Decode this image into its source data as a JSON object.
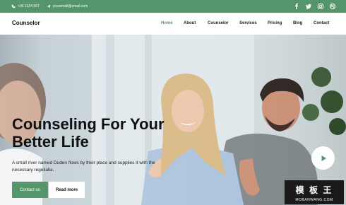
{
  "topbar": {
    "phone": "+00 1234 567",
    "email": "youremail@email.com",
    "social": [
      "facebook-icon",
      "twitter-icon",
      "instagram-icon",
      "dribbble-icon"
    ]
  },
  "navbar": {
    "brand": "Counselor",
    "items": [
      {
        "label": "Home",
        "active": true
      },
      {
        "label": "About",
        "active": false
      },
      {
        "label": "Counselor",
        "active": false
      },
      {
        "label": "Services",
        "active": false
      },
      {
        "label": "Pricing",
        "active": false
      },
      {
        "label": "Blog",
        "active": false
      },
      {
        "label": "Contact",
        "active": false
      }
    ]
  },
  "hero": {
    "title": "Counseling For Your\nBetter Life",
    "description": "A small river named Duden flows by their place and supplies it with the necessary regelialia.",
    "primary_button": "Contact us",
    "secondary_button": "Read more",
    "play_icon": "play-icon"
  },
  "watermark": {
    "line1": "模 板 王",
    "line2": "MOBANWANG.COM"
  },
  "colors": {
    "accent": "#55956b",
    "text_dark": "#111111"
  }
}
